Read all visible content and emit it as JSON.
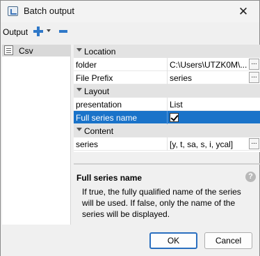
{
  "window": {
    "title": "Batch output",
    "close_glyph": "✕",
    "icon": "app-window-icon"
  },
  "toolbar": {
    "label": "Output",
    "add_icon": "plus-icon",
    "remove_icon": "minus-icon"
  },
  "tree": {
    "items": [
      {
        "label": "Csv",
        "icon": "csv-file-icon",
        "selected": true
      }
    ]
  },
  "grid": {
    "categories": [
      {
        "label": "Location",
        "properties": [
          {
            "name": "folder",
            "value": "C:\\Users\\UTZK0M\\...",
            "has_button": true
          },
          {
            "name": "File Prefix",
            "value": "series",
            "has_button": true
          }
        ]
      },
      {
        "label": "Layout",
        "properties": [
          {
            "name": "presentation",
            "value": "List"
          },
          {
            "name": "Full series name",
            "value_checked": true,
            "selected": true
          }
        ]
      },
      {
        "label": "Content",
        "properties": [
          {
            "name": "series",
            "value": "[y, t, sa, s, i, ycal]",
            "has_button": true
          }
        ]
      }
    ],
    "ellipsis": "..."
  },
  "description": {
    "title": "Full series name",
    "text": "If true, the fully qualified name of the series will be used. If false, only the name of the series will be displayed.",
    "help_glyph": "?"
  },
  "buttons": {
    "ok": "OK",
    "cancel": "Cancel"
  },
  "colors": {
    "selection": "#1a73c9",
    "accent": "#2f78c8"
  }
}
